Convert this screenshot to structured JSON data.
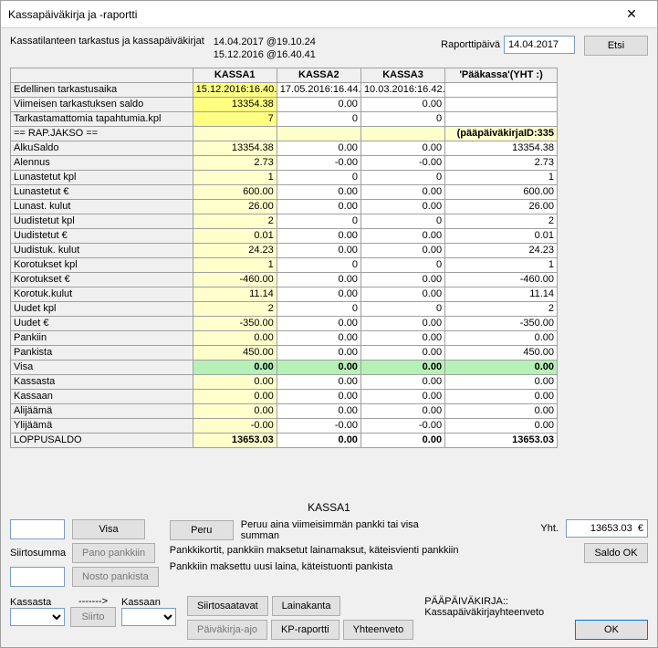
{
  "title": "Kassapäiväkirja ja -raportti",
  "top": {
    "label": "Kassatilanteen tarkastus ja kassapäiväkirjat",
    "stamp1": "14.04.2017 @19.10.24",
    "stamp2": "15.12.2016 @16.40.41",
    "raporttipaiva_lbl": "Raporttipäivä",
    "raporttipaiva_val": "14.04.2017",
    "etsi": "Etsi"
  },
  "grid": {
    "cols": [
      "KASSA1",
      "KASSA2",
      "KASSA3",
      "'Pääkassa'(YHT :)"
    ],
    "rows": [
      {
        "label": "Edellinen tarkastusaika",
        "c": [
          "15.12.2016:16.40.",
          "17.05.2016:16.44.",
          "10.03.2016:16.42.",
          ""
        ],
        "style": [
          "dyellow",
          "",
          "",
          ""
        ],
        "align": [
          "left",
          "left",
          "left",
          "left"
        ]
      },
      {
        "label": "Viimeisen tarkastuksen saldo",
        "c": [
          "13354.38",
          "0.00",
          "0.00",
          ""
        ],
        "style": [
          "dyellow",
          "",
          "",
          ""
        ],
        "align": [
          "left",
          "center",
          "center",
          "left"
        ]
      },
      {
        "label": "Tarkastamattomia tapahtumia.kpl",
        "c": [
          "7",
          "0",
          "0",
          ""
        ],
        "style": [
          "dyellow",
          "",
          "",
          ""
        ],
        "align": [
          "left",
          "left",
          "left",
          "left"
        ]
      },
      {
        "label": "== RAP.JAKSO ==",
        "c": [
          "",
          "",
          "",
          "(pääpäiväkirjaID:335"
        ],
        "rowstyle": "yellow",
        "bold": true,
        "align": [
          "left",
          "left",
          "left",
          "left"
        ]
      },
      {
        "label": "AlkuSaldo",
        "c": [
          "13354.38",
          "0.00",
          "0.00",
          "13354.38"
        ],
        "style": [
          "yellow",
          "",
          "",
          ""
        ]
      },
      {
        "label": "Alennus",
        "c": [
          "2.73",
          "-0.00",
          "-0.00",
          "2.73"
        ],
        "style": [
          "yellow",
          "",
          "",
          ""
        ]
      },
      {
        "label": "Lunastetut kpl",
        "c": [
          "1",
          "0",
          "0",
          "1"
        ],
        "hdrcenter": true,
        "style": [
          "yellow",
          "",
          "",
          ""
        ],
        "align": [
          "left",
          "left",
          "left",
          "left"
        ]
      },
      {
        "label": "Lunastetut €",
        "c": [
          "600.00",
          "0.00",
          "0.00",
          "600.00"
        ],
        "style": [
          "yellow",
          "",
          "",
          ""
        ]
      },
      {
        "label": "Lunast. kulut",
        "c": [
          "26.00",
          "0.00",
          "0.00",
          "26.00"
        ],
        "style": [
          "yellow",
          "",
          "",
          ""
        ]
      },
      {
        "label": "Uudistetut kpl",
        "c": [
          "2",
          "0",
          "0",
          "2"
        ],
        "hdrcenter": true,
        "style": [
          "yellow",
          "",
          "",
          ""
        ],
        "align": [
          "left",
          "left",
          "left",
          "left"
        ]
      },
      {
        "label": "Uudistetut €",
        "c": [
          "0.01",
          "0.00",
          "0.00",
          "0.01"
        ],
        "style": [
          "yellow",
          "",
          "",
          ""
        ]
      },
      {
        "label": "Uudistuk. kulut",
        "c": [
          "24.23",
          "0.00",
          "0.00",
          "24.23"
        ],
        "style": [
          "yellow",
          "",
          "",
          ""
        ]
      },
      {
        "label": "Korotukset kpl",
        "c": [
          "1",
          "0",
          "0",
          "1"
        ],
        "hdrcenter": true,
        "style": [
          "yellow",
          "",
          "",
          ""
        ],
        "align": [
          "left",
          "left",
          "left",
          "left"
        ]
      },
      {
        "label": "Korotukset €",
        "c": [
          "-460.00",
          "0.00",
          "0.00",
          "-460.00"
        ],
        "style": [
          "yellow",
          "",
          "",
          ""
        ]
      },
      {
        "label": "Korotuk.kulut",
        "c": [
          "11.14",
          "0.00",
          "0.00",
          "11.14"
        ],
        "style": [
          "yellow",
          "",
          "",
          ""
        ]
      },
      {
        "label": "Uudet kpl",
        "c": [
          "2",
          "0",
          "0",
          "2"
        ],
        "hdrcenter": true,
        "style": [
          "yellow",
          "",
          "",
          ""
        ],
        "align": [
          "left",
          "left",
          "left",
          "left"
        ]
      },
      {
        "label": "Uudet €",
        "c": [
          "-350.00",
          "0.00",
          "0.00",
          "-350.00"
        ],
        "style": [
          "yellow",
          "",
          "",
          ""
        ]
      },
      {
        "label": "Pankiin",
        "c": [
          "0.00",
          "0.00",
          "0.00",
          "0.00"
        ],
        "style": [
          "yellow",
          "",
          "",
          ""
        ]
      },
      {
        "label": "Pankista",
        "c": [
          "450.00",
          "0.00",
          "0.00",
          "450.00"
        ],
        "style": [
          "yellow",
          "",
          "",
          ""
        ]
      },
      {
        "label": "Visa",
        "c": [
          "0.00",
          "0.00",
          "0.00",
          "0.00"
        ],
        "rowstyle": "green",
        "bold": true
      },
      {
        "label": "Kassasta",
        "c": [
          "0.00",
          "0.00",
          "0.00",
          "0.00"
        ],
        "style": [
          "yellow",
          "",
          "",
          ""
        ]
      },
      {
        "label": "Kassaan",
        "c": [
          "0.00",
          "0.00",
          "0.00",
          "0.00"
        ],
        "style": [
          "yellow",
          "",
          "",
          ""
        ]
      },
      {
        "label": "Alijäämä",
        "c": [
          "0.00",
          "0.00",
          "0.00",
          "0.00"
        ],
        "style": [
          "yellow",
          "",
          "",
          ""
        ]
      },
      {
        "label": "Ylijäämä",
        "c": [
          "-0.00",
          "-0.00",
          "-0.00",
          "0.00"
        ],
        "style": [
          "yellow",
          "",
          "",
          ""
        ]
      },
      {
        "label": "LOPPUSALDO",
        "c": [
          "13653.03",
          "0.00",
          "0.00",
          "13653.03"
        ],
        "style": [
          "yellow",
          "",
          "",
          ""
        ],
        "bold": true
      }
    ]
  },
  "bottom": {
    "kassa_title": "KASSA1",
    "visa_btn": "Visa",
    "peru_btn": "Peru",
    "peru_desc": "Peruu aina viimeisimmän pankki tai visa summan",
    "siirtosumma_lbl": "Siirtosumma",
    "pano_btn": "Pano pankkiin",
    "nosto_btn": "Nosto pankista",
    "pano_desc": "Pankkikortit, pankkiin maksetut lainamaksut, käteisvienti pankkiin",
    "nosto_desc": "Pankkiin maksettu uusi laina, käteistuonti pankista",
    "yht_lbl": "Yht.",
    "yht_val": "13653.03  €",
    "saldo_ok": "Saldo OK",
    "kassasta_lbl": "Kassasta",
    "arrow": "------->",
    "kassaan_lbl": "Kassaan",
    "siirto_btn": "Siirto",
    "siirtosaatavat": "Siirtosaatavat",
    "lainakanta": "Lainakanta",
    "paivakirjaajo": "Päiväkirja-ajo",
    "kpraportti": "KP-raportti",
    "yhteenveto": "Yhteenveto",
    "pp_title": "PÄÄPÄIVÄKIRJA::",
    "pp_sub": "Kassapäiväkirjayhteenveto",
    "ok": "OK"
  }
}
